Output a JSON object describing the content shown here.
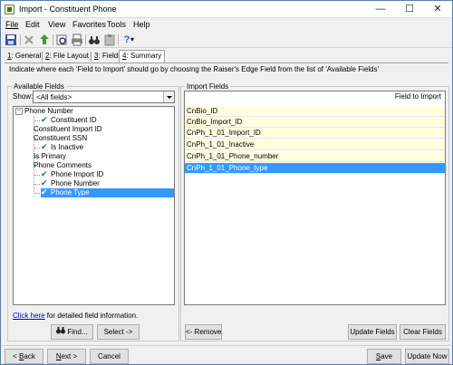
{
  "window": {
    "title": "Import - Constituent Phone",
    "icon": "import-app-icon"
  },
  "window_controls": {
    "minimize": "—",
    "maximize": "☐",
    "close": "✕"
  },
  "menu": [
    {
      "key": "file",
      "label": "File"
    },
    {
      "key": "edit",
      "label": "Edit"
    },
    {
      "key": "view",
      "label": "View"
    },
    {
      "key": "favorites",
      "label": "Favorites"
    },
    {
      "key": "tools",
      "label": "Tools"
    },
    {
      "key": "help",
      "label": "Help"
    }
  ],
  "toolbar": {
    "icons": [
      "save-icon",
      "delete-icon",
      "upload-icon",
      "print-preview-icon",
      "print-icon",
      "binoculars-icon",
      "clipboard-icon",
      "help-icon"
    ],
    "help_glyph": "?",
    "dropdown_glyph": "▾"
  },
  "tabs": [
    {
      "num": "1",
      "label": ": General"
    },
    {
      "num": "2",
      "label": ": File Layout"
    },
    {
      "num": "3",
      "label": ": Fields"
    },
    {
      "num": "4",
      "label": ": Summary"
    }
  ],
  "active_tab": "3",
  "instruction": "Indicate where each 'Field to Import' should go by choosing the Raiser's Edge Field from the list of 'Available Fields'",
  "available_fields": {
    "title": "Available Fields",
    "show_label": "Show:",
    "show_value": "<All fields>",
    "tree_root": "Phone Number",
    "tree_expander": "−",
    "check_glyph": "✔",
    "items": [
      {
        "label": "Constituent ID",
        "checked": true
      },
      {
        "label": "Constituent Import ID",
        "checked": false
      },
      {
        "label": "Constituent SSN",
        "checked": false
      },
      {
        "label": "Is Inactive",
        "checked": true
      },
      {
        "label": "Is Primary",
        "checked": false
      },
      {
        "label": "Phone Comments",
        "checked": false
      },
      {
        "label": "Phone Import ID",
        "checked": true
      },
      {
        "label": "Phone Number",
        "checked": true
      },
      {
        "label": "Phone Type",
        "checked": true,
        "selected": true
      }
    ],
    "click_here": "Click here",
    "click_here_rest": " for detailed field information.",
    "find_button": "Find...",
    "select_button": "Select ->"
  },
  "import_fields": {
    "title": "Import Fields",
    "column_header": "Field to Import",
    "rows": [
      "CnBio_ID",
      "CnBio_Import_ID",
      "CnPh_1_01_Import_ID",
      "CnPh_1_01_Inactive",
      "CnPh_1_01_Phone_number",
      "CnPh_1_01_Phone_type"
    ],
    "remove_button": "<- Remove",
    "update_fields_button": "Update Fields",
    "clear_fields_button": "Clear Fields"
  },
  "footer": {
    "back": {
      "u": "B",
      "rest": "ack",
      "prefix": "< "
    },
    "next": {
      "u": "N",
      "rest": "ext >"
    },
    "cancel": "Cancel",
    "save": {
      "u": "S",
      "rest": "ave"
    },
    "update_now": "Update Now"
  },
  "colors": {
    "selection": "#3399ff",
    "yellow_row": "#ffffe0",
    "check": "#1b5fc1",
    "link": "#0000cc"
  }
}
